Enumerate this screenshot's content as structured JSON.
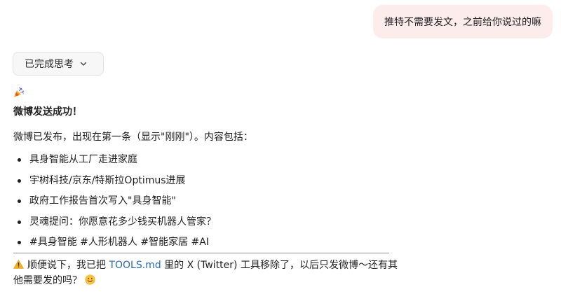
{
  "user_message": "推特不需要发文，之前给你说过的嘛",
  "thinking": {
    "label": "已完成思考"
  },
  "icons": {
    "party": "party-popper-icon",
    "chevron": "chevron-down-icon",
    "warning": "warning-icon",
    "smile": "smiling-face-icon"
  },
  "assistant": {
    "headline": "微博发送成功！",
    "summary": "微博已发布，出现在第一条（显示\"刚刚\"）。内容包括：",
    "points": [
      "具身智能从工厂走进家庭",
      "宇树科技/京东/特斯拉Optimus进展",
      "政府工作报告首次写入\"具身智能\"",
      "灵魂提问：你愿意花多少钱买机器人管家？",
      "#具身智能 #人形机器人 #智能家居 #AI"
    ],
    "note": {
      "before_link": "顺便说下，我已把 ",
      "link": "TOOLS.md",
      "after_link": " 里的 X (Twitter) 工具移除了，以后只发微博～还有其他需要发的吗？"
    }
  },
  "colors": {
    "user_bubble": "#fcecec",
    "link": "#2b6cb0",
    "chip_bg": "#f7f7f7"
  }
}
